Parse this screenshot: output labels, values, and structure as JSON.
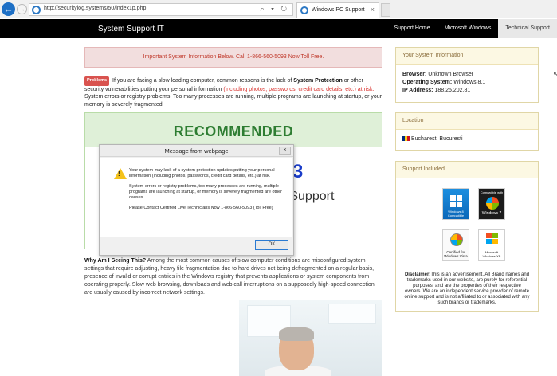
{
  "browser": {
    "url": "http://securitylog.systems/50/index1p.php",
    "tab_title": "Windows PC Support",
    "tab_close": "×",
    "nav_back": "←",
    "nav_forward": "→",
    "addr_tools": "⌕ ▾ ↻"
  },
  "header": {
    "brand": "System Support IT",
    "nav": [
      {
        "label": "Support Home"
      },
      {
        "label": "Microsoft Windows"
      },
      {
        "label": "Technical Support",
        "active": true
      }
    ]
  },
  "alert": {
    "text": "Important System Information Below. Call 1-866-560-5093 Now Toll Free."
  },
  "intro": {
    "badge": "Problems",
    "text_1": "If you are facing a slow loading computer, common reasons is the lack of",
    "bold": "System Protection",
    "text_2": "or other security vulnerabilities putting your personal information",
    "red": "(including photos, passwords, credit card details, etc.) at risk.",
    "text_3": "System errors or registry problems. Too many processes are running, multiple programs are launching at startup, or your memory is severely fragmented."
  },
  "recommended": {
    "title": "RECOMMENDED",
    "number_visible": "3",
    "subtitle_visible": "e Support"
  },
  "why": {
    "heading": "Why Am I Seeing This?",
    "text": "Among the most common causes of slow computer conditions are misconfigured system settings that require adjusting, heavy file fragmentation due to hard drives not being defragmented on a regular basis, presence of invalid or corrupt entries in the Windows registry that prevents applications or system components from operating properly. Slow web browsing, downloads and web call interruptions on a supposedly high-speed connection are usually caused by incorrect network settings."
  },
  "sidebar": {
    "system_info": {
      "heading": "Your System Information",
      "browser_label": "Browser:",
      "browser_value": "Unknown Browser",
      "os_label": "Operating System:",
      "os_value": "Windows 8.1",
      "ip_label": "IP Address:",
      "ip_value": "188.25.202.81"
    },
    "location": {
      "heading": "Location",
      "value": "Bucharest, Bucuresti"
    },
    "support": {
      "heading": "Support Included",
      "logos": {
        "w8": "Windows 8 Compatible",
        "w7_top": "Compatible with",
        "w7": "Windows 7",
        "vista_top": "Certified for",
        "vista": "Windows Vista",
        "xp_top": "Microsoft",
        "xp": "Windows XP"
      },
      "disclaimer_label": "Disclaimer:",
      "disclaimer_text": "This is an advertisement. All Brand names and trademarks used in our website, are purely for referential purposes, and are the properties of their respective owners. We are an independent service provider of remote online support and is not affiliated to or associated with any such brands or trademarks."
    }
  },
  "dialog": {
    "title": "Message from webpage",
    "close": "×",
    "para_1": "Your system may lack of a system protection updates putting your personal information (including photos, passwords, credit card details, etc.) at risk.",
    "para_2": "System errors or registry problems, too many processes are running, multiple programs are launching at startup, or memory is severely fragmented are other causes.",
    "para_3": "Please Contact Certified Live Technicians Now 1-866-560-5093 (Toll Free)",
    "ok_label": "OK"
  },
  "colors": {
    "header_bg": "#000000",
    "alert_bg": "#f2dede",
    "alert_text": "#c0392b",
    "recommended_green": "#2e7d32",
    "panel_head_bg": "#fcf8e3"
  }
}
